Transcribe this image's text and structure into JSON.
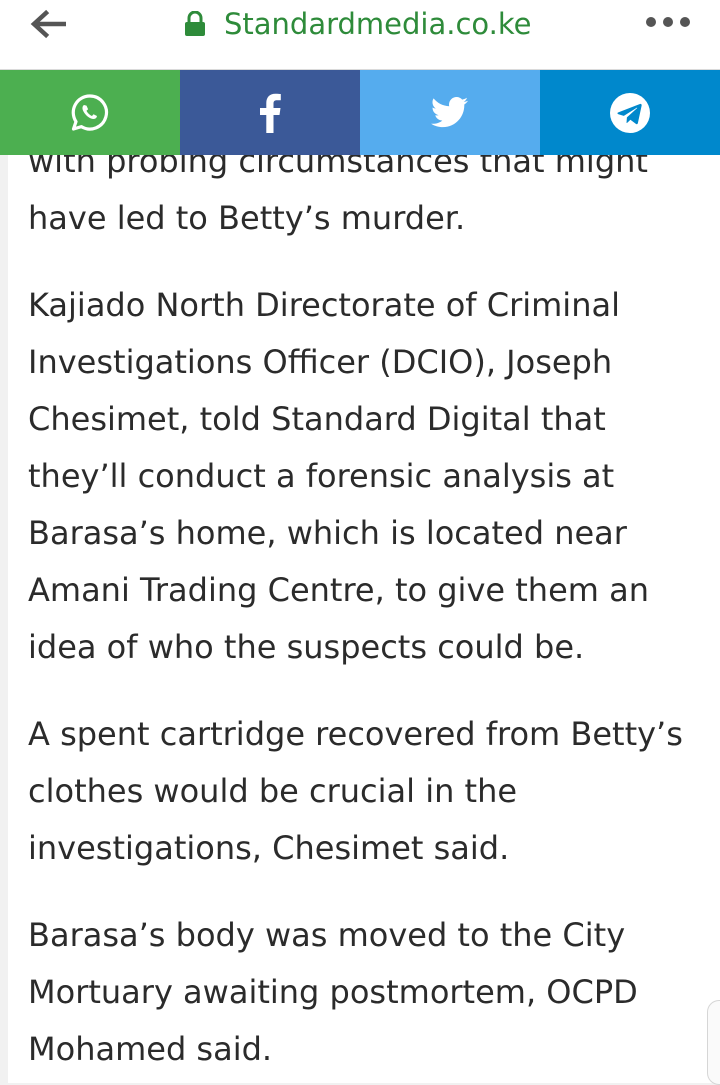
{
  "browser": {
    "url": "Standardmedia.co.ke",
    "back_icon": "arrow-left-icon",
    "lock_icon": "lock-icon",
    "menu_icon": "more-horizontal-icon",
    "url_color": "#2e8b3a"
  },
  "share_bar": {
    "buttons": [
      {
        "network": "whatsapp",
        "icon": "whatsapp-icon",
        "color": "#4caf50"
      },
      {
        "network": "facebook",
        "icon": "facebook-icon",
        "color": "#3b5998"
      },
      {
        "network": "twitter",
        "icon": "twitter-icon",
        "color": "#55acee"
      },
      {
        "network": "telegram",
        "icon": "telegram-icon",
        "color": "#0088cc"
      }
    ]
  },
  "article": {
    "paragraphs": [
      "with probing circumstances that might\nhave led to Betty’s murder.",
      "Kajiado North Directorate of Criminal\nInvestigations Officer (DCIO), Joseph\nChesimet, told Standard Digital that\nthey’ll conduct a forensic analysis at\nBarasa’s home, which is located near\nAmani Trading Centre, to give them an\nidea of who the suspects could be.",
      "A spent cartridge recovered from Betty’s\nclothes would be crucial in the\ninvestigations, Chesimet said.",
      "Barasa’s body was moved to the City\nMortuary awaiting postmortem, OCPD\nMohamed said."
    ]
  }
}
